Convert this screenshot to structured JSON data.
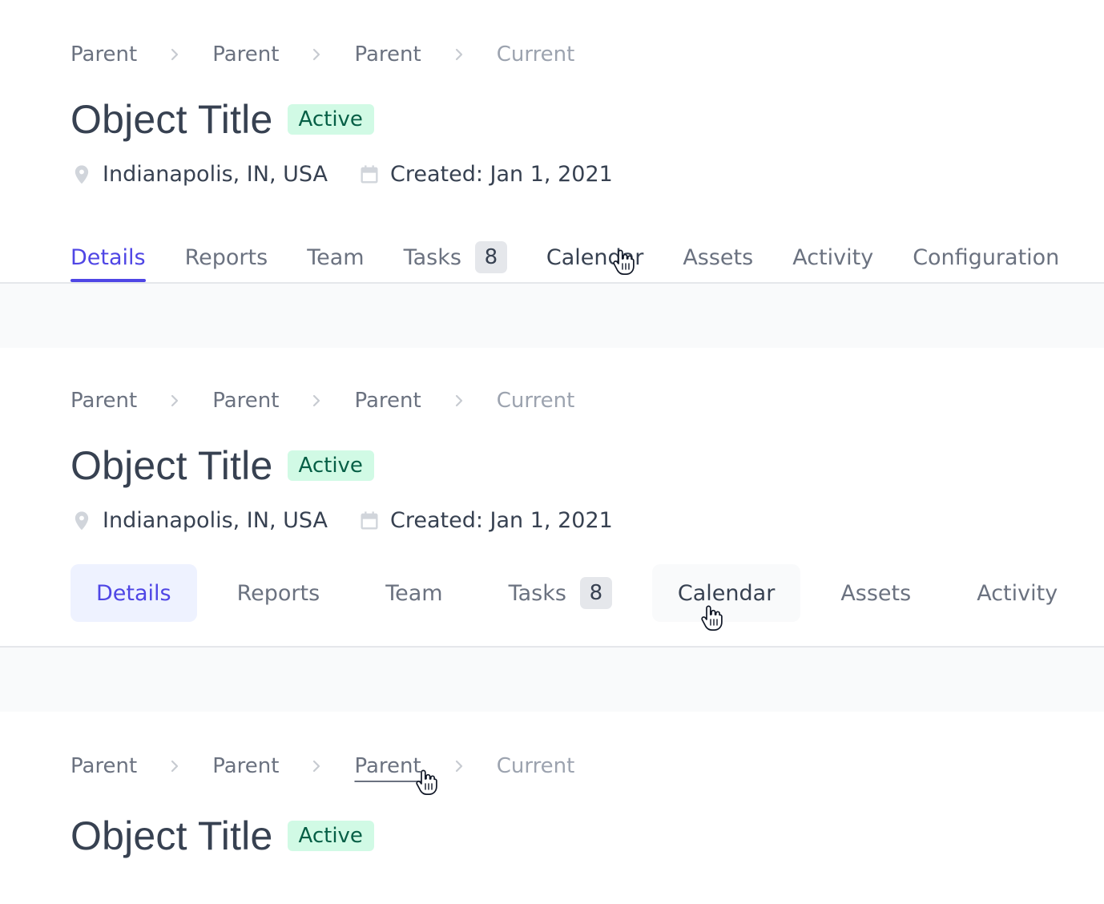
{
  "breadcrumb": {
    "items": [
      "Parent",
      "Parent",
      "Parent",
      "Current"
    ]
  },
  "object": {
    "title": "Object Title",
    "status": "Active"
  },
  "meta": {
    "location": "Indianapolis, IN, USA",
    "created": "Created: Jan 1, 2021"
  },
  "tabs_underline": {
    "items": [
      {
        "label": "Details"
      },
      {
        "label": "Reports"
      },
      {
        "label": "Team"
      },
      {
        "label": "Tasks",
        "count": "8"
      },
      {
        "label": "Calendar"
      },
      {
        "label": "Assets"
      },
      {
        "label": "Activity"
      },
      {
        "label": "Configuration"
      }
    ]
  },
  "tabs_pill": {
    "items": [
      {
        "label": "Details"
      },
      {
        "label": "Reports"
      },
      {
        "label": "Team"
      },
      {
        "label": "Tasks",
        "count": "8"
      },
      {
        "label": "Calendar"
      },
      {
        "label": "Assets"
      },
      {
        "label": "Activity"
      }
    ]
  },
  "colors": {
    "brand": "#4f46e5",
    "text": "#374151",
    "muted": "#6b7280",
    "status_bg": "#d1fae5",
    "status_text": "#065f46",
    "divider": "#e5e7eb"
  },
  "icons": {
    "location": "location-pin-icon",
    "calendar": "calendar-icon",
    "separator": "chevron-right-icon",
    "pointer": "hand-pointer-icon"
  }
}
